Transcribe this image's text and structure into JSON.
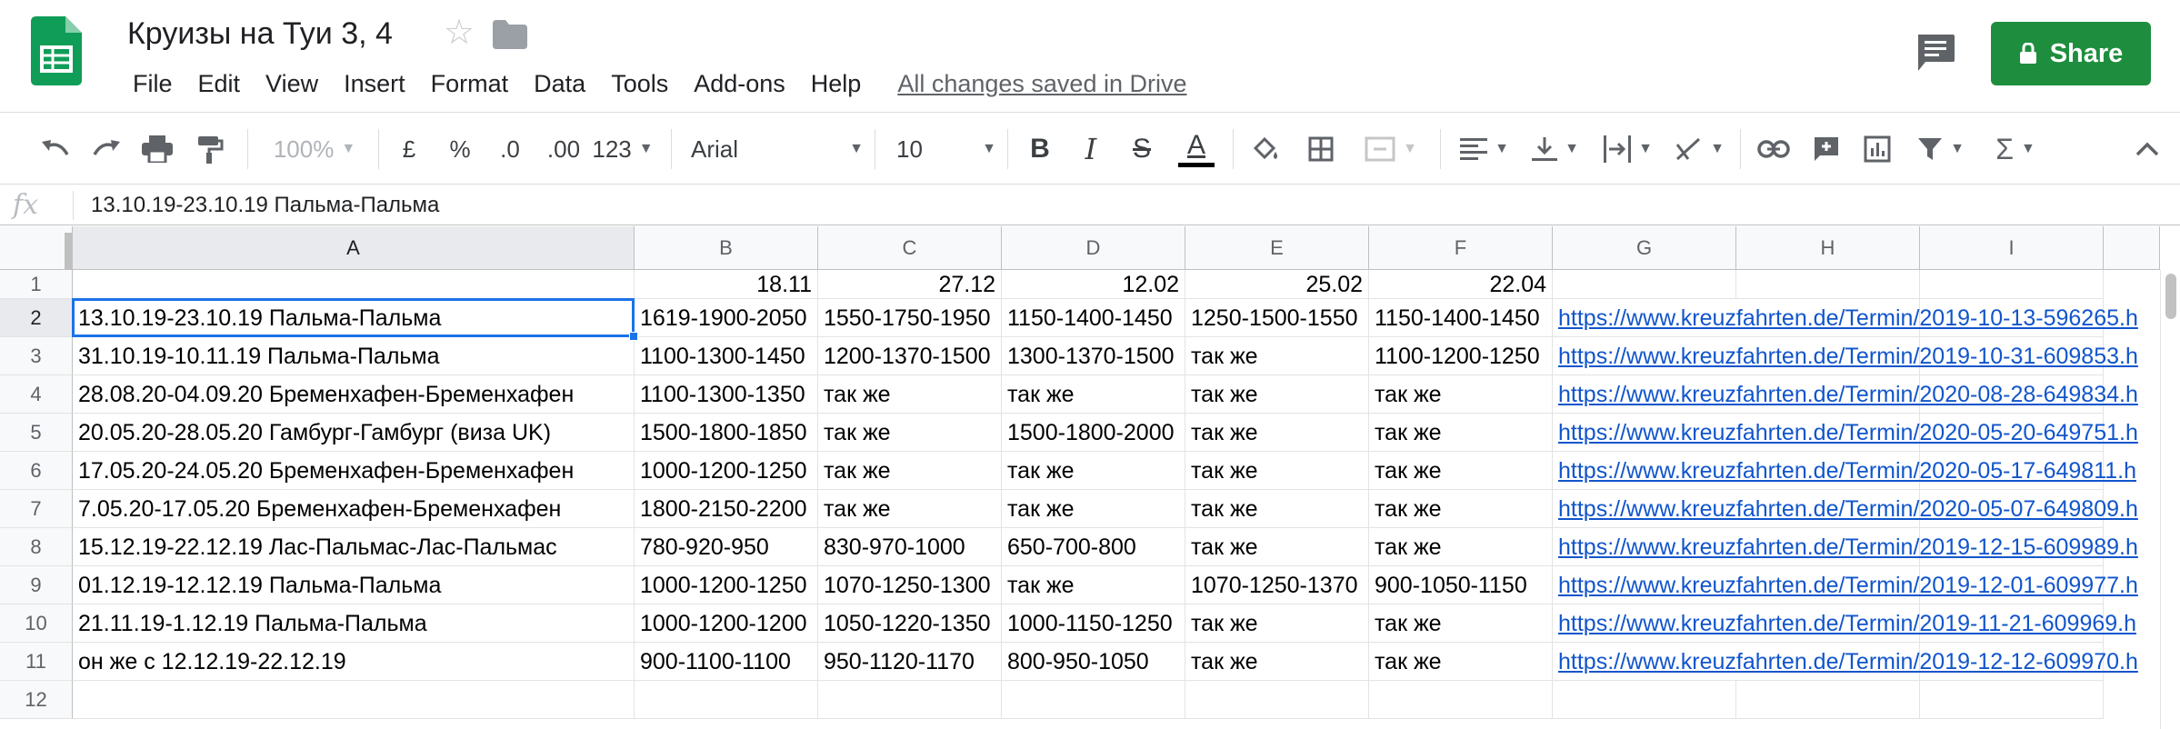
{
  "app": {
    "doc_title": "Круизы на Туи 3, 4",
    "save_status": "All changes saved in Drive",
    "share_label": "Share",
    "brand_color": "#0f9d58",
    "share_color": "#1e8e3e"
  },
  "menu": [
    "File",
    "Edit",
    "View",
    "Insert",
    "Format",
    "Data",
    "Tools",
    "Add-ons",
    "Help"
  ],
  "toolbar": {
    "zoom": "100%",
    "currency": "£",
    "percent": "%",
    "dec_decrease": ".0",
    "dec_increase": ".00",
    "more_formats": "123",
    "font": "Arial",
    "font_size": "10",
    "bold": "B",
    "italic": "I",
    "strike": "S",
    "text_color": "A"
  },
  "formula_bar": {
    "fx": "fx",
    "value": "13.10.19-23.10.19 Пальма-Пальма"
  },
  "columns": [
    "A",
    "B",
    "C",
    "D",
    "E",
    "F",
    "G",
    "H",
    "I"
  ],
  "row_numbers": [
    "1",
    "2",
    "3",
    "4",
    "5",
    "6",
    "7",
    "8",
    "9",
    "10",
    "11",
    "12"
  ],
  "rows": [
    [
      "",
      "18.11",
      "27.12",
      "12.02",
      "25.02",
      "22.04",
      ""
    ],
    [
      "13.10.19-23.10.19 Пальма-Пальма",
      "1619-1900-2050",
      "1550-1750-1950",
      "1150-1400-1450",
      "1250-1500-1550",
      "1150-1400-1450",
      "https://www.kreuzfahrten.de/Termin/2019-10-13-596265.h"
    ],
    [
      "31.10.19-10.11.19 Пальма-Пальма",
      "1100-1300-1450",
      "1200-1370-1500",
      "1300-1370-1500",
      "так же",
      "1100-1200-1250",
      "https://www.kreuzfahrten.de/Termin/2019-10-31-609853.h"
    ],
    [
      "28.08.20-04.09.20 Бременхафен-Бременхафен",
      "1100-1300-1350",
      "так же",
      "так же",
      "так же",
      "так же",
      "https://www.kreuzfahrten.de/Termin/2020-08-28-649834.h"
    ],
    [
      "20.05.20-28.05.20 Гамбург-Гамбург (виза UK)",
      "1500-1800-1850",
      "так же",
      "1500-1800-2000",
      "так же",
      "так же",
      "https://www.kreuzfahrten.de/Termin/2020-05-20-649751.h"
    ],
    [
      "17.05.20-24.05.20 Бременхафен-Бременхафен",
      "1000-1200-1250",
      "так же",
      "так же",
      "так же",
      "так же",
      "https://www.kreuzfahrten.de/Termin/2020-05-17-649811.h"
    ],
    [
      "7.05.20-17.05.20 Бременхафен-Бременхафен",
      "1800-2150-2200",
      "так же",
      "так же",
      "так же",
      "так же",
      "https://www.kreuzfahrten.de/Termin/2020-05-07-649809.h"
    ],
    [
      "15.12.19-22.12.19 Лас-Пальмас-Лас-Пальмас",
      "780-920-950",
      "830-970-1000",
      "650-700-800",
      "так же",
      "так же",
      "https://www.kreuzfahrten.de/Termin/2019-12-15-609989.h"
    ],
    [
      "01.12.19-12.12.19 Пальма-Пальма",
      "1000-1200-1250",
      "1070-1250-1300",
      "так же",
      "1070-1250-1370",
      "900-1050-1150",
      "https://www.kreuzfahrten.de/Termin/2019-12-01-609977.h"
    ],
    [
      "21.11.19-1.12.19 Пальма-Пальма",
      "1000-1200-1200",
      "1050-1220-1350",
      "1000-1150-1250",
      "так же",
      "так же",
      "https://www.kreuzfahrten.de/Termin/2019-11-21-609969.h"
    ],
    [
      "он же с 12.12.19-22.12.19",
      "900-1100-1100",
      "950-1120-1170",
      "800-950-1050",
      "так же",
      "так же",
      "https://www.kreuzfahrten.de/Termin/2019-12-12-609970.h"
    ],
    [
      "",
      "",
      "",
      "",
      "",
      "",
      ""
    ]
  ]
}
